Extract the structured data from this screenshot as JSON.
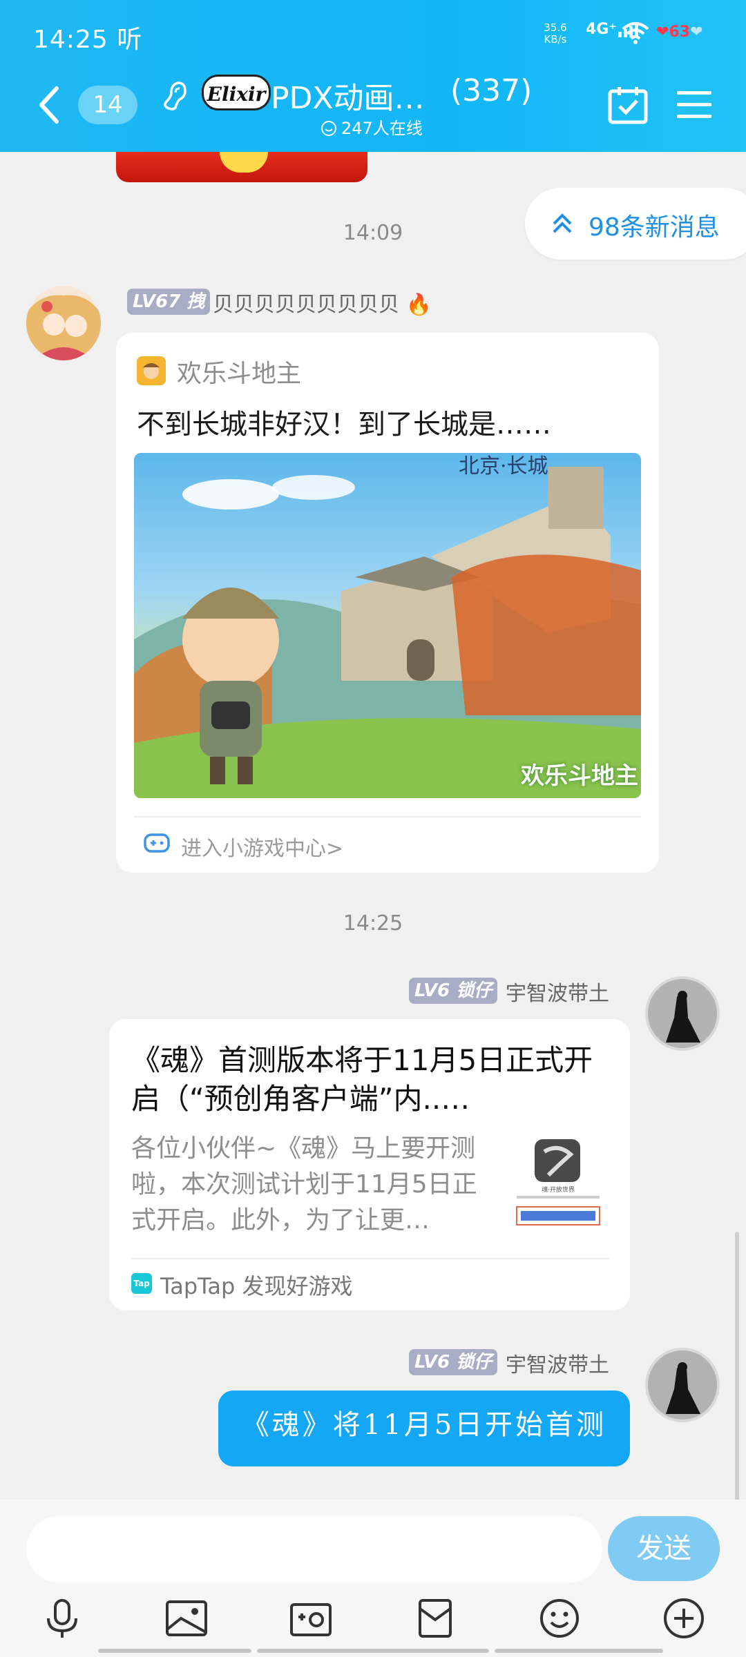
{
  "status_bar": {
    "time": "14:25 听",
    "net_speed_value": "35.6",
    "net_speed_unit": "KB/s",
    "signal": "4G⁺",
    "battery": "63"
  },
  "header": {
    "back_count": "14",
    "logo_text": "Elixir",
    "group_name": "PDX动画…",
    "member_count": "(337)",
    "online": "247人在线"
  },
  "new_messages_pill": "98条新消息",
  "messages": [
    {
      "time": "14:09",
      "level": "LV67 拽",
      "nickname": "贝贝贝贝贝贝贝贝贝",
      "card": {
        "app_name": "欢乐斗地主",
        "title": "不到长城非好汉！到了长城是……",
        "image_text_top": "北京·长城",
        "image_logo": "欢乐斗地主",
        "link": "进入小游戏中心>"
      }
    },
    {
      "time": "14:25",
      "level": "LV6 锁仔",
      "nickname": "宇智波带土",
      "card": {
        "title": "《魂》首测版本将于11月5日正式开启（“预创角客户端”内..…",
        "desc": "各位小伙伴~《魂》马上要开测啦，本次测试计划于11月5日正式开启。此外，为了让更…",
        "thumb_caption": "魂·开放世界",
        "tap_icon": "Tap",
        "source": "TapTap 发现好游戏"
      }
    },
    {
      "level": "LV6 锁仔",
      "nickname": "宇智波带土",
      "text": "《魂》将11月5日开始首测"
    }
  ],
  "input": {
    "placeholder": "",
    "send_label": "发送"
  },
  "toolbar": [
    "mic-icon",
    "image-icon",
    "camera-icon",
    "red-packet-icon",
    "emoji-icon",
    "plus-icon"
  ]
}
